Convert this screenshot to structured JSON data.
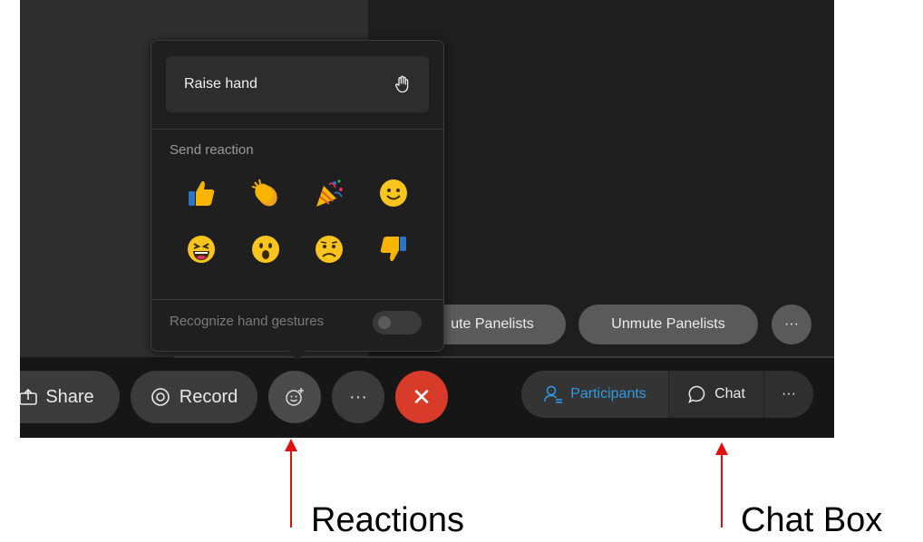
{
  "toolbar": {
    "share_label": "Share",
    "record_label": "Record",
    "more_label": "···",
    "end_label": "✕"
  },
  "right_controls": {
    "participants_label": "Participants",
    "chat_label": "Chat",
    "more_label": "···"
  },
  "panelists": {
    "mute_label": "ute Panelists",
    "unmute_label": "Unmute Panelists",
    "more_label": "···"
  },
  "reactions_menu": {
    "raise_hand_label": "Raise hand",
    "send_reaction_label": "Send reaction",
    "emojis": [
      "thumbs-up",
      "clapping",
      "celebrate",
      "smile",
      "laugh",
      "wow",
      "sad",
      "thumbs-down"
    ],
    "gesture_label": "Recognize hand gestures",
    "gesture_enabled": false
  },
  "annotations": {
    "reactions_caption": "Reactions",
    "chat_caption": "Chat Box",
    "arrow_color": "#e01010"
  },
  "colors": {
    "accent": "#2f9be3",
    "end_call": "#d93b2b"
  }
}
